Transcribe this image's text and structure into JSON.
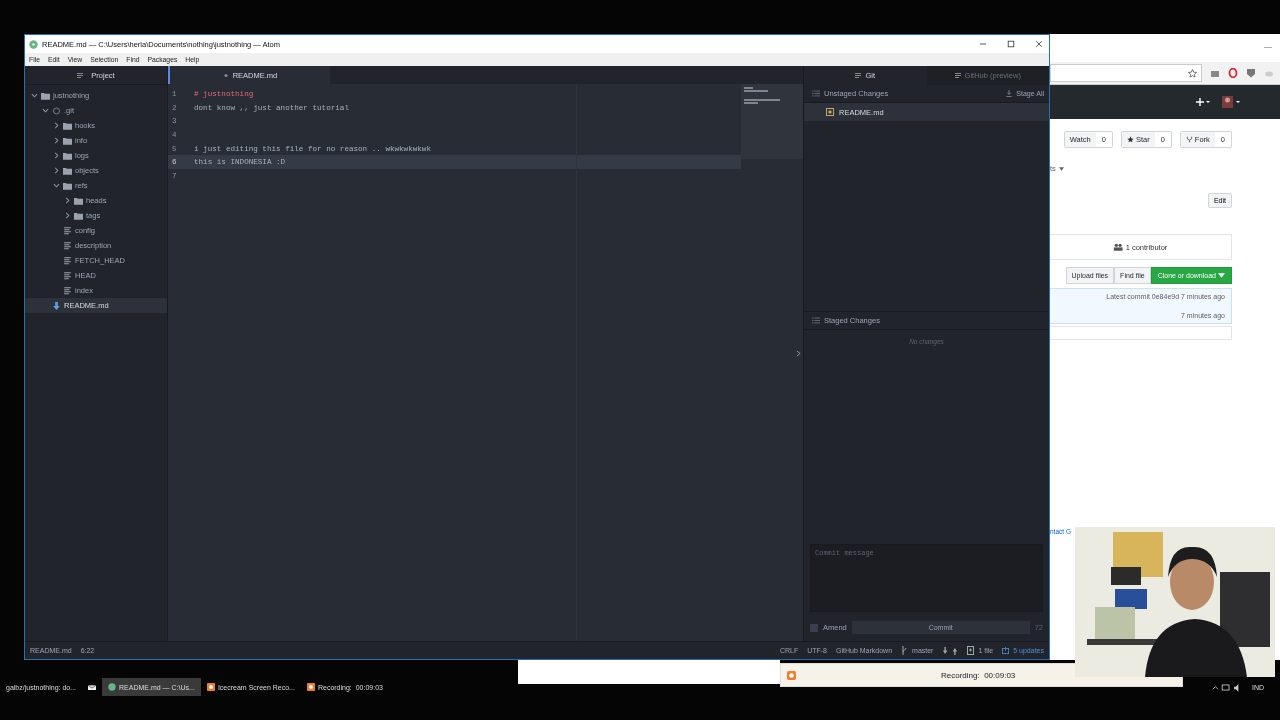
{
  "atom_window": {
    "title": "README.md — C:\\Users\\herla\\Documents\\nothing\\justnothing — Atom",
    "menu": [
      "File",
      "Edit",
      "View",
      "Selection",
      "Find",
      "Packages",
      "Help"
    ],
    "project_panel": {
      "title": "Project",
      "tree": [
        {
          "label": "justnothing",
          "kind": "folder",
          "expanded": true,
          "selected": false,
          "children": [
            {
              "label": ".git",
              "kind": "repo",
              "expanded": true,
              "selected": false,
              "children": [
                {
                  "label": "hooks",
                  "kind": "folder",
                  "expanded": false,
                  "selected": false
                },
                {
                  "label": "info",
                  "kind": "folder",
                  "expanded": false,
                  "selected": false
                },
                {
                  "label": "logs",
                  "kind": "folder",
                  "expanded": false,
                  "selected": false
                },
                {
                  "label": "objects",
                  "kind": "folder",
                  "expanded": false,
                  "selected": false
                },
                {
                  "label": "refs",
                  "kind": "folder",
                  "expanded": true,
                  "selected": false,
                  "children": [
                    {
                      "label": "heads",
                      "kind": "folder",
                      "expanded": false,
                      "selected": false
                    },
                    {
                      "label": "tags",
                      "kind": "folder",
                      "expanded": false,
                      "selected": false
                    }
                  ]
                },
                {
                  "label": "config",
                  "kind": "file",
                  "selected": false
                },
                {
                  "label": "description",
                  "kind": "file",
                  "selected": false
                },
                {
                  "label": "FETCH_HEAD",
                  "kind": "file",
                  "selected": false
                },
                {
                  "label": "HEAD",
                  "kind": "file",
                  "selected": false
                },
                {
                  "label": "index",
                  "kind": "file",
                  "selected": false
                }
              ]
            },
            {
              "label": "README.md",
              "kind": "markdown",
              "selected": true
            }
          ]
        }
      ]
    },
    "editor": {
      "tabs": [
        {
          "label": "README.md",
          "selected": true
        }
      ],
      "lines": [
        {
          "number": "1",
          "text": "# justnothing",
          "kind": "heading",
          "cursor": false
        },
        {
          "number": "2",
          "text": "dont know ,, just another tutorial",
          "kind": "plain",
          "cursor": false
        },
        {
          "number": "3",
          "cursor": false
        },
        {
          "number": "4",
          "cursor": false
        },
        {
          "number": "5",
          "text": "i just editing this file for no reason .. wkwkwkwkwk",
          "kind": "plain",
          "cursor": false
        },
        {
          "number": "6",
          "text": "this is INDONESIA :D",
          "kind": "plain",
          "cursor": true
        },
        {
          "number": "7",
          "cursor": false
        }
      ]
    },
    "git_panel": {
      "tabs": [
        {
          "label": "Git",
          "selected": true
        },
        {
          "label": "GitHub (preview)",
          "selected": false
        }
      ],
      "unstaged": {
        "title": "Unstaged Changes",
        "action": "Stage All",
        "files": [
          {
            "label": "README.md",
            "selected": true
          }
        ]
      },
      "staged": {
        "title": "Staged Changes",
        "empty_text": "No changes"
      },
      "commit": {
        "placeholder": "Commit message",
        "amend_label": "Amend",
        "amend_checked": false,
        "button": "Commit",
        "count": "72"
      }
    },
    "status_bar": {
      "file": "README.md",
      "position": "6:22",
      "line_ending": "CRLF",
      "encoding": "UTF-8",
      "grammar": "GitHub Markdown",
      "branch": "master",
      "changes": "1 file",
      "updates": "5 updates"
    }
  },
  "browser": {
    "partial_tab": "ts",
    "buttons": [
      {
        "label": "Watch",
        "count": "0"
      },
      {
        "label": "Star",
        "count": "0"
      },
      {
        "label": "Fork",
        "count": "0"
      }
    ],
    "edit": "Edit",
    "contributors": "1 contributor",
    "file_buttons": [
      "Upload files",
      "Find file"
    ],
    "clone": "Clone or download",
    "latest_commit": "Latest commit 0e84e9d 7 minutes ago",
    "commit_time": "7 minutes ago",
    "footer_link": "ntact G"
  },
  "recorder": {
    "status": "Recording:  00:09:03"
  },
  "taskbar": {
    "items": [
      {
        "label": "gaibz/justnothing: do...",
        "kind": "text",
        "selected": false
      },
      {
        "kind": "mail",
        "selected": false
      },
      {
        "label": "README.md — C:\\Us...",
        "kind": "atom",
        "selected": true
      },
      {
        "label": "Icecream Screen Reco...",
        "kind": "recorder",
        "selected": false
      },
      {
        "label": "Recording:  00:09:03",
        "kind": "recorder",
        "selected": false
      }
    ],
    "language": "IND"
  }
}
